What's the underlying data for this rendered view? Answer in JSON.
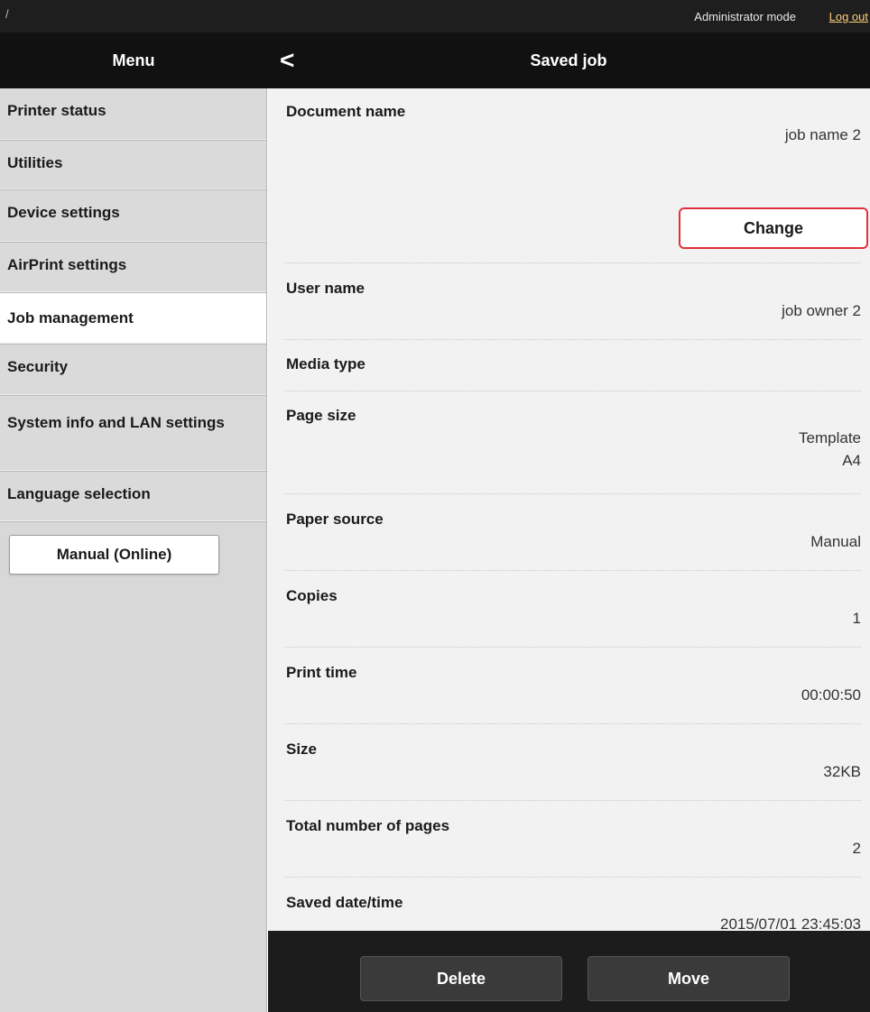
{
  "topbar": {
    "slash": "/",
    "mode_text": "Administrator mode",
    "logout_label": "Log out"
  },
  "header": {
    "menu_title": "Menu",
    "back_icon": "<",
    "page_title": "Saved job"
  },
  "sidebar": {
    "items": [
      {
        "label": "Printer status"
      },
      {
        "label": "Utilities"
      },
      {
        "label": "Device settings"
      },
      {
        "label": "AirPrint settings"
      },
      {
        "label": "Job management"
      },
      {
        "label": "Security"
      },
      {
        "label": "System info and LAN settings"
      },
      {
        "label": "Language selection"
      }
    ],
    "manual_button": "Manual (Online)"
  },
  "job": {
    "document_name": {
      "label": "Document name",
      "value": "job name 2",
      "change_label": "Change"
    },
    "user_name": {
      "label": "User name",
      "value": "job owner 2"
    },
    "media_type": {
      "label": "Media type"
    },
    "page_size": {
      "label": "Page size",
      "value_line1": "Template",
      "value_line2": "A4"
    },
    "paper_source": {
      "label": "Paper source",
      "value": "Manual"
    },
    "copies": {
      "label": "Copies",
      "value": "1"
    },
    "print_time": {
      "label": "Print time",
      "value": "00:00:50"
    },
    "size": {
      "label": "Size",
      "value": "32KB"
    },
    "total_pages": {
      "label": "Total number of pages",
      "value": "2"
    },
    "saved_datetime": {
      "label": "Saved date/time",
      "value": "2015/07/01 23:45:03"
    }
  },
  "footer": {
    "delete_label": "Delete",
    "move_label": "Move"
  },
  "colors": {
    "highlight_border": "#e0313a",
    "logout_link": "#ffcf7a"
  }
}
